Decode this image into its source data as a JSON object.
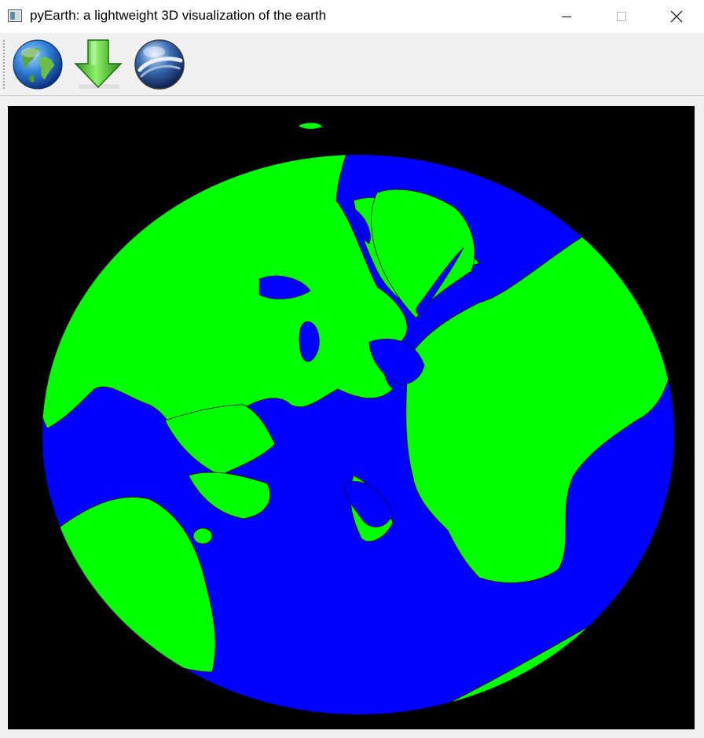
{
  "window": {
    "title": "pyEarth: a lightweight 3D visualization of the earth",
    "controls": {
      "minimize_icon": "minimize-icon",
      "maximize_icon": "maximize-icon",
      "close_icon": "close-icon"
    }
  },
  "toolbar": {
    "buttons": [
      {
        "icon": "globe-icon"
      },
      {
        "icon": "download-arrow-icon"
      },
      {
        "icon": "google-earth-icon"
      }
    ]
  },
  "viewport": {
    "background": "#000000",
    "ocean_color": "#0000ff",
    "land_color": "#00ff00",
    "border_color": "#000000"
  }
}
